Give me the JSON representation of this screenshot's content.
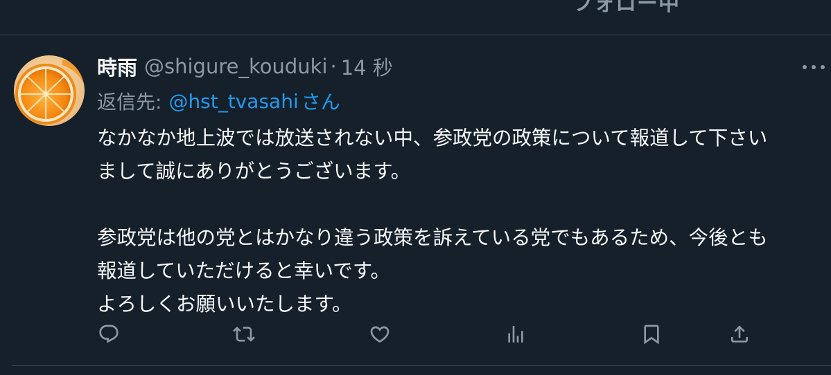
{
  "header": {
    "follow_label": "フォロー中"
  },
  "tweet": {
    "display_name": "時雨",
    "handle": "@shigure_kouduki",
    "separator": "·",
    "time": "14 秒",
    "reply_label": "返信先:",
    "reply_to": "@hst_tvasahi",
    "reply_suffix": "さん",
    "body": {
      "lines": [
        "なかなか地上波では放送されない中、参政党の政策について報道して下さい",
        "まして誠にありがとうございます。",
        "",
        "参政党は他の党とはかなり違う政策を訴えている党でもあるため、今後とも",
        "報道していただけると幸いです。",
        "よろしくお願いいたします。"
      ]
    }
  },
  "actions": {
    "reply_icon": "reply-icon",
    "retweet_icon": "retweet-icon",
    "like_icon": "heart-icon",
    "views_icon": "analytics-icon",
    "bookmark_icon": "bookmark-icon",
    "share_icon": "share-icon"
  },
  "colors": {
    "background": "#15202b",
    "text_primary": "#f7f9f9",
    "text_secondary": "#8b98a5",
    "accent": "#1d9bf0",
    "divider": "#38444d"
  }
}
